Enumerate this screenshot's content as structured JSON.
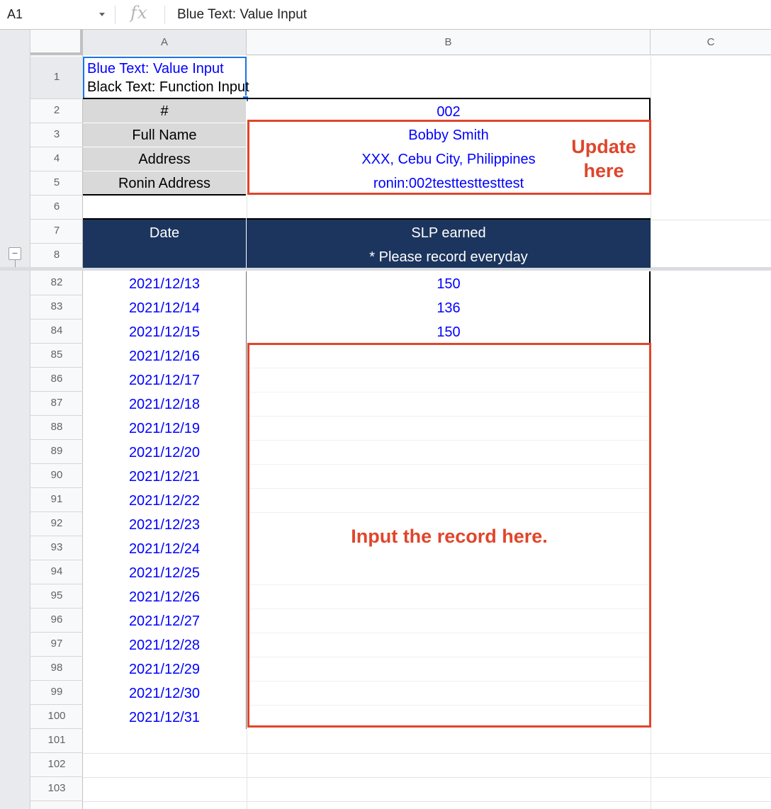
{
  "formula_bar": {
    "name_box": "A1",
    "fx_label": "fx",
    "content": "Blue Text: Value Input"
  },
  "columns": [
    "A",
    "B",
    "C"
  ],
  "legend": {
    "blue_line": "Blue Text: Value Input",
    "black_line": "Black Text: Function Input"
  },
  "info": {
    "number_label": "#",
    "number_value": "002",
    "name_label": "Full Name",
    "name_value": "Bobby Smith",
    "address_label": "Address",
    "address_value": "XXX, Cebu City, Philippines",
    "ronin_label": "Ronin Address",
    "ronin_value": "ronin:002testtesttesttest"
  },
  "table_header": {
    "date": "Date",
    "slp": "SLP earned",
    "note": "* Please record everyday"
  },
  "records": [
    {
      "row": "82",
      "date": "2021/12/13",
      "slp": "150"
    },
    {
      "row": "83",
      "date": "2021/12/14",
      "slp": "136"
    },
    {
      "row": "84",
      "date": "2021/12/15",
      "slp": "150"
    },
    {
      "row": "85",
      "date": "2021/12/16",
      "slp": ""
    },
    {
      "row": "86",
      "date": "2021/12/17",
      "slp": ""
    },
    {
      "row": "87",
      "date": "2021/12/18",
      "slp": ""
    },
    {
      "row": "88",
      "date": "2021/12/19",
      "slp": ""
    },
    {
      "row": "89",
      "date": "2021/12/20",
      "slp": ""
    },
    {
      "row": "90",
      "date": "2021/12/21",
      "slp": ""
    },
    {
      "row": "91",
      "date": "2021/12/22",
      "slp": ""
    },
    {
      "row": "92",
      "date": "2021/12/23",
      "slp": ""
    },
    {
      "row": "93",
      "date": "2021/12/24",
      "slp": ""
    },
    {
      "row": "94",
      "date": "2021/12/25",
      "slp": ""
    },
    {
      "row": "95",
      "date": "2021/12/26",
      "slp": ""
    },
    {
      "row": "96",
      "date": "2021/12/27",
      "slp": ""
    },
    {
      "row": "97",
      "date": "2021/12/28",
      "slp": ""
    },
    {
      "row": "98",
      "date": "2021/12/29",
      "slp": ""
    },
    {
      "row": "99",
      "date": "2021/12/30",
      "slp": ""
    },
    {
      "row": "100",
      "date": "2021/12/31",
      "slp": ""
    }
  ],
  "top_rows": [
    "1",
    "2",
    "3",
    "4",
    "5",
    "6",
    "7",
    "8"
  ],
  "bottom_rows": [
    "101",
    "102",
    "103"
  ],
  "annotations": {
    "update_line1": "Update",
    "update_line2": "here",
    "input_note": "Input the record here."
  },
  "colors": {
    "value_input": "#0000ff",
    "header_fill": "#1c355e",
    "label_fill": "#d9d9d9",
    "annotation": "#e0452b",
    "selection": "#1a73e8"
  }
}
